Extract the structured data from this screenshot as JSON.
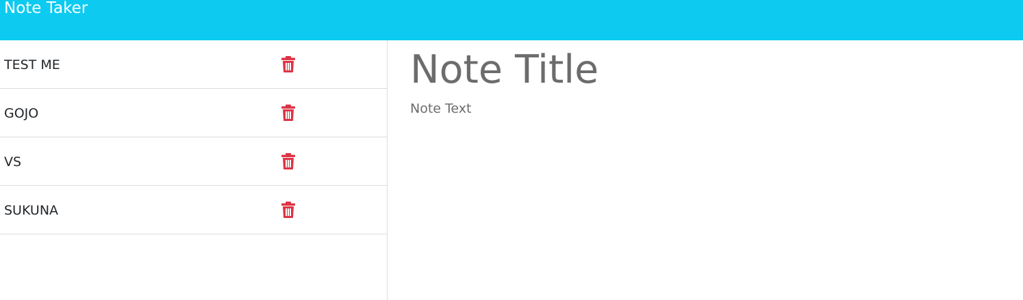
{
  "app": {
    "title": "Note Taker"
  },
  "colors": {
    "navbar": "#0dcaf0",
    "delete_icon": "#dc3545",
    "divider": "#dcdcdc",
    "placeholder": "#6c6c6c"
  },
  "notes": [
    {
      "title": "TEST ME",
      "delete_icon": "trash-icon"
    },
    {
      "title": "GOJO",
      "delete_icon": "trash-icon"
    },
    {
      "title": "VS",
      "delete_icon": "trash-icon"
    },
    {
      "title": "SUKUNA",
      "delete_icon": "trash-icon"
    }
  ],
  "editor": {
    "title_placeholder": "Note Title",
    "text_placeholder": "Note Text"
  }
}
